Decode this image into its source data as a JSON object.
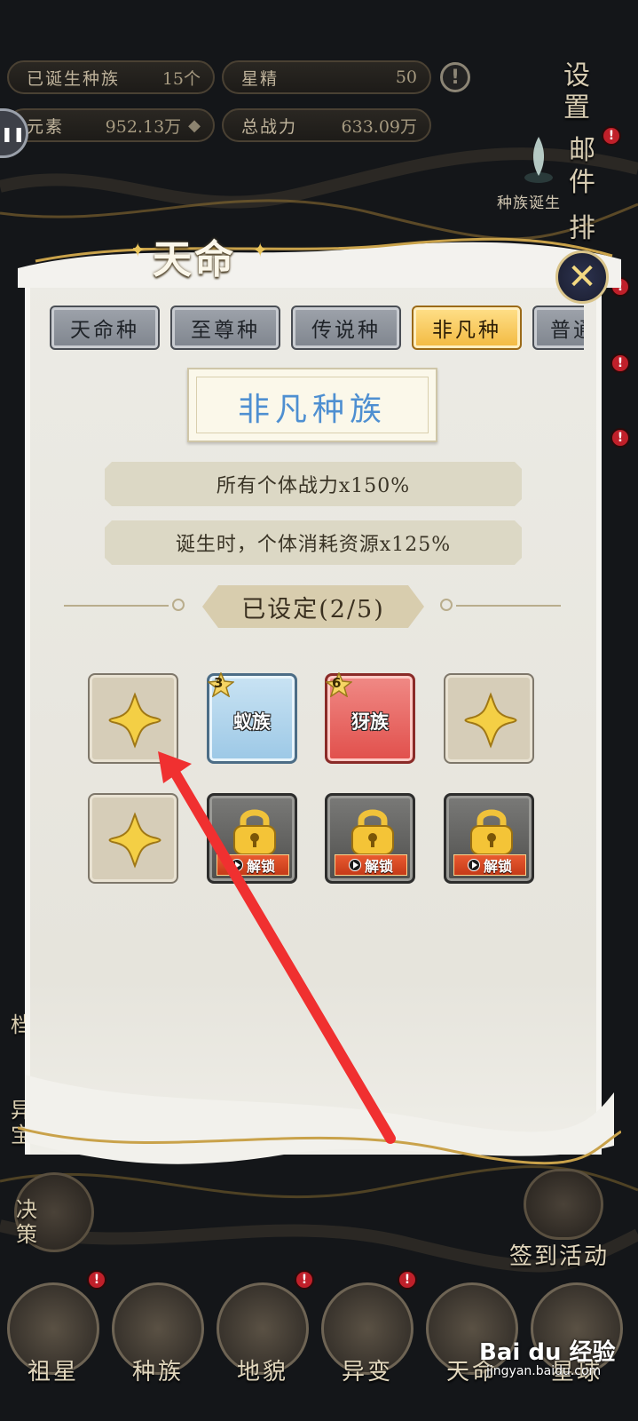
{
  "stats": {
    "races_born": {
      "label": "已诞生种族",
      "value": "15个"
    },
    "star_essence": {
      "label": "星精",
      "value": "50"
    },
    "elements": {
      "label": "元素",
      "value": "952.13万"
    },
    "total_power": {
      "label": "总战力",
      "value": "633.09万"
    }
  },
  "info_symbol": "!",
  "side_menu": {
    "settings": "设置",
    "mail": "邮件",
    "rank": "排"
  },
  "race_birth": "种族诞生",
  "dialog": {
    "title": "天命",
    "close_symbol": "✕",
    "tabs": [
      {
        "label": "天命种",
        "active": false
      },
      {
        "label": "至尊种",
        "active": false
      },
      {
        "label": "传说种",
        "active": false
      },
      {
        "label": "非凡种",
        "active": true
      },
      {
        "label": "普通",
        "active": false
      }
    ],
    "race_title": "非凡种族",
    "bonuses": [
      "所有个体战力x150%",
      "诞生时，个体消耗资源x125%"
    ],
    "set_count": "已设定(2/5)",
    "slots": [
      {
        "type": "empty"
      },
      {
        "type": "race",
        "name": "蚁族",
        "level": "3",
        "color": "#9cc8e6"
      },
      {
        "type": "race",
        "name": "犽族",
        "level": "6",
        "color": "#e14f4b"
      },
      {
        "type": "empty"
      },
      {
        "type": "empty"
      },
      {
        "type": "locked",
        "unlock_label": "解锁"
      },
      {
        "type": "locked",
        "unlock_label": "解锁"
      },
      {
        "type": "locked",
        "unlock_label": "解锁"
      }
    ]
  },
  "left_menu": {
    "decision": "决策",
    "partial_1": "档",
    "partial_2": "异宝"
  },
  "sign_in_activity": "签到活动",
  "bottom_nav": [
    "祖星",
    "种族",
    "地貌",
    "异变",
    "天命",
    "星球"
  ],
  "watermark": {
    "logo": "Bai du 经验",
    "url": "jingyan.baidu.com"
  },
  "colors": {
    "accent_gold": "#f2b940",
    "race_title_blue": "#4e8fd1",
    "alert_red": "#c0202a",
    "annotation_arrow": "#f03030"
  }
}
